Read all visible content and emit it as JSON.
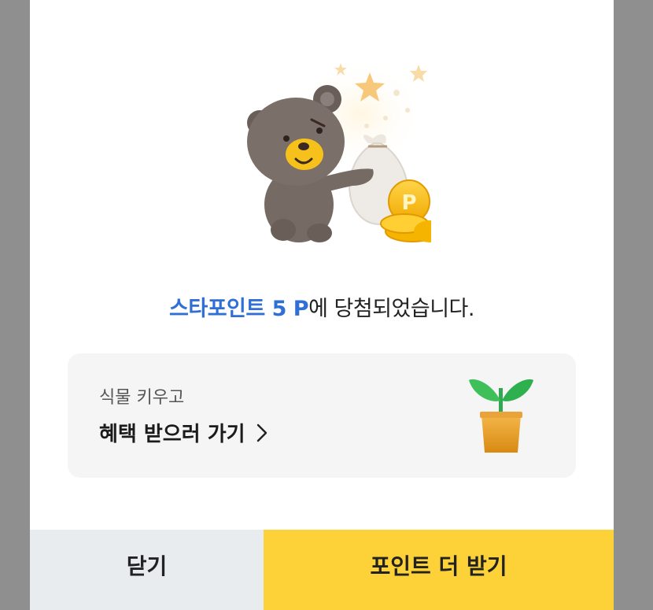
{
  "result": {
    "highlight": "스타포인트 5 P",
    "suffix": "에 당첨되었습니다."
  },
  "promo": {
    "subtitle": "식물 키우고",
    "title": "혜택 받으러 가기",
    "chevron_icon": "chevron-right-icon",
    "plant_icon": "sprout-pot-icon"
  },
  "buttons": {
    "close_label": "닫기",
    "more_label": "포인트 더 받기"
  },
  "illustration": {
    "icon": "bear-money-bag-coins-illustration",
    "coin_letter": "P"
  },
  "colors": {
    "highlight": "#2f6fd6",
    "primary_button": "#fdd138",
    "secondary_button": "#e9ecef",
    "card_bg": "#f5f5f5",
    "overlay": "#8f8f8f"
  }
}
